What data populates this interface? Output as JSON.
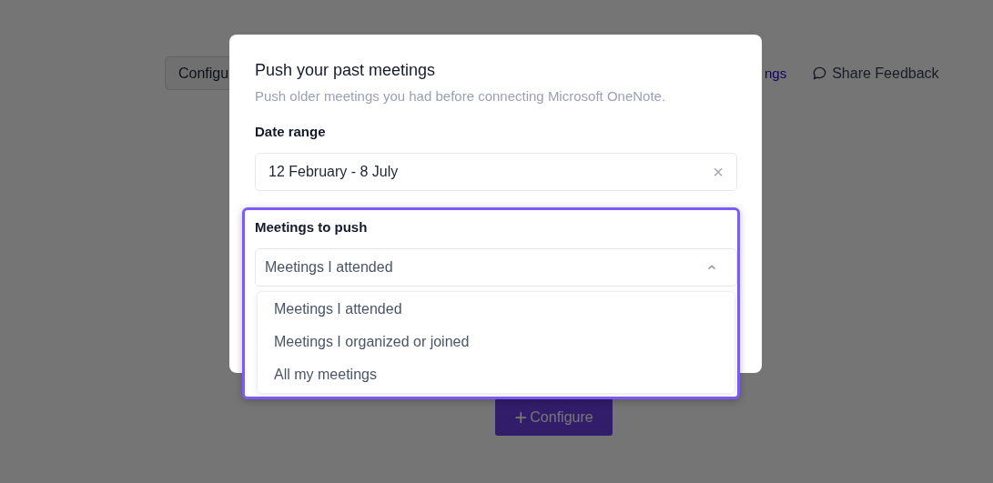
{
  "background": {
    "configure_tab": "Configu",
    "settings_link": "ngs",
    "feedback_link": "Share Feedback",
    "configure_button": "Configure",
    "configure_icon": "+"
  },
  "modal": {
    "title": "Push your past meetings",
    "subtitle": "Push older meetings you had before connecting Microsoft OneNote.",
    "date_label": "Date range",
    "date_value": "12 February - 8 July",
    "clear_icon": "×"
  },
  "meetings": {
    "label": "Meetings to push",
    "value": "Meetings I attended",
    "expanded": true,
    "options": [
      "Meetings I attended",
      "Meetings I organized or joined",
      "All my meetings"
    ]
  }
}
